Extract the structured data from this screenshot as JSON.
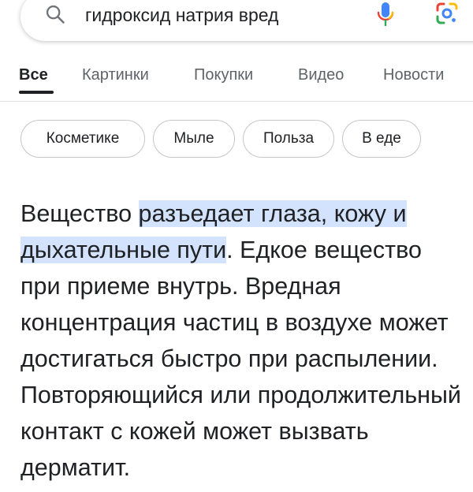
{
  "search": {
    "query": "гидроксид натрия вред"
  },
  "tabs": [
    {
      "label": "Все",
      "active": true
    },
    {
      "label": "Картинки",
      "active": false
    },
    {
      "label": "Покупки",
      "active": false
    },
    {
      "label": "Видео",
      "active": false
    },
    {
      "label": "Новости",
      "active": false
    }
  ],
  "chips": [
    {
      "label": "Косметике"
    },
    {
      "label": "Мыле"
    },
    {
      "label": "Польза"
    },
    {
      "label": "В еде"
    }
  ],
  "answer": {
    "lead": "Вещество ",
    "highlight": "разъедает глаза, кожу и дыхательные пути",
    "rest": ". Едкое вещество при приеме внутрь. Вредная концентрация частиц в воздухе может достигаться быстро при распылении. Повторяющийся или продолжительный контакт с кожей может вызвать дерматит.",
    "highlight_color": "#d3e3fd"
  },
  "icons": {
    "search": "search-icon",
    "mic": "mic-icon",
    "lens": "google-lens-icon"
  },
  "colors": {
    "google_blue": "#4285F4",
    "google_red": "#EA4335",
    "google_yellow": "#FBBC05",
    "google_green": "#34A853",
    "active_tab": "#202124",
    "inactive_tab": "#5f6368"
  }
}
